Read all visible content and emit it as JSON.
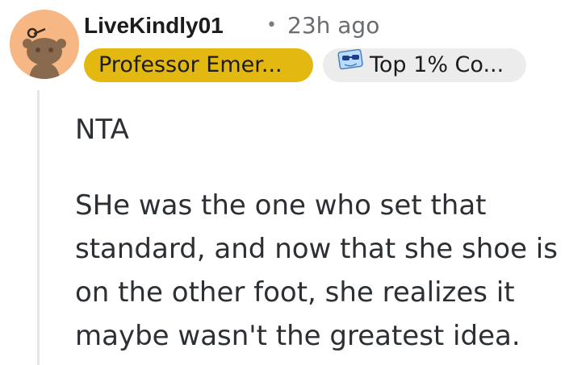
{
  "comment": {
    "username": "LiveKindly01",
    "separator": "•",
    "timestamp": "23h ago",
    "flairs": [
      {
        "label": "Professor Emer...",
        "color": "#e3b911"
      },
      {
        "label": "Top 1% Co...",
        "color": "#ececec",
        "icon": "sunglasses-award-icon"
      }
    ],
    "avatar_icon": "snoo-avatar-icon",
    "avatar_color": "#f6b784",
    "paragraphs": [
      "NTA",
      "SHe was the one who set that standard, and now that she shoe is on the other foot, she realizes it maybe wasn't the greatest idea."
    ]
  }
}
